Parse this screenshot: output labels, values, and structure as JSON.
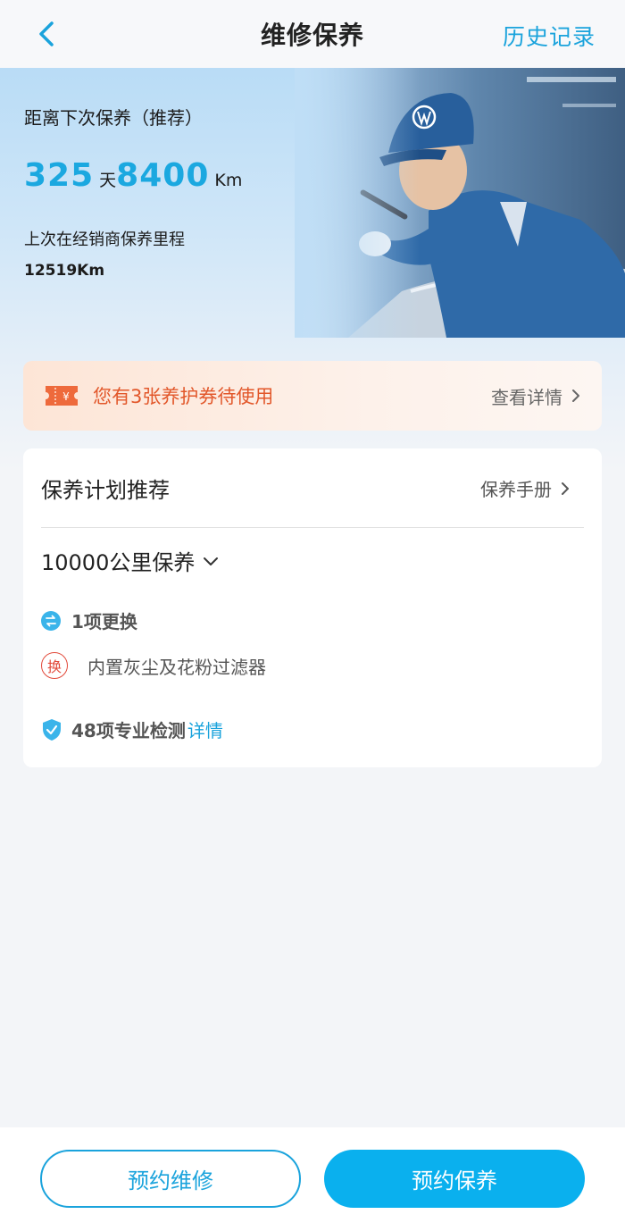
{
  "header": {
    "title": "维修保养",
    "history_label": "历史记录"
  },
  "hero": {
    "next_maintenance_label": "距离下次保养（推荐）",
    "days_value": "325",
    "days_unit": "天",
    "km_value": "8400",
    "km_unit": "Km",
    "last_mileage_label": "上次在经销商保养里程",
    "last_mileage_value": "12519Km"
  },
  "coupon": {
    "text": "您有3张养护券待使用",
    "link_label": "查看详情"
  },
  "plan_card": {
    "title": "保养计划推荐",
    "manual_label": "保养手册",
    "selected_plan": "10000公里保养",
    "replace_summary": "1项更换",
    "replace_badge": "换",
    "replace_items": [
      "内置灰尘及花粉过滤器"
    ],
    "check_summary": "48项专业检测",
    "check_link": "详情"
  },
  "bottom": {
    "repair_button": "预约维修",
    "maintenance_button": "预约保养"
  },
  "colors": {
    "accent": "#1aa3dc",
    "accent_button": "#0ab0ee",
    "coupon_text": "#e2572a",
    "replace_badge": "#e24a3b"
  }
}
